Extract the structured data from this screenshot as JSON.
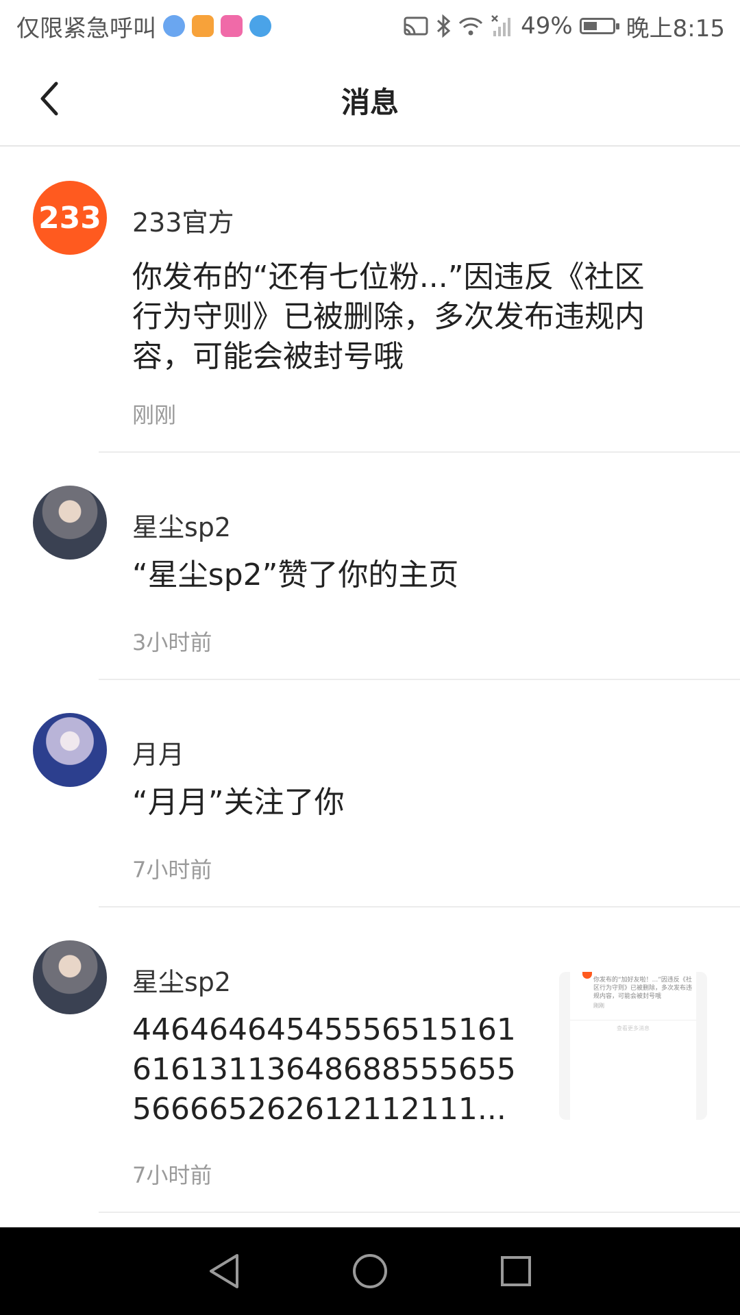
{
  "status_bar": {
    "left_text": "仅限紧急呼叫",
    "battery": "49%",
    "battery_level": 0.49,
    "time": "晚上8:15",
    "app_icons": [
      "music-app-icon",
      "video-app-icon",
      "shop-app-icon",
      "browser-app-icon"
    ]
  },
  "header": {
    "title": "消息",
    "back_icon": "chevron-left-icon"
  },
  "messages": [
    {
      "sender": "233官方",
      "content": "你发布的“还有七位粉...”因违反《社区行为守则》已被删除，多次发布违规内容，可能会被封号哦",
      "time": "刚刚",
      "avatar_text": "233",
      "avatar_color": "#ff5a1f"
    },
    {
      "sender": "星尘sp2",
      "content": "“星尘sp2”赞了你的主页",
      "time": "3小时前"
    },
    {
      "sender": "月月",
      "content": "“月月”关注了你",
      "time": "7小时前"
    },
    {
      "sender": "星尘sp2",
      "content": "4464646454555651516161613113648688555655566665262612112111...",
      "time": "7小时前",
      "thumbnail_text": "你发布的“加好友啦！...”因违反《社区行为守则》已被删除，多次发布违规内容，可能会被封号哦",
      "thumbnail_time": "刚刚",
      "thumbnail_footer": "查看更多消息"
    }
  ],
  "nav_bar": {
    "back": "triangle-back-icon",
    "home": "circle-home-icon",
    "recents": "square-recents-icon"
  }
}
